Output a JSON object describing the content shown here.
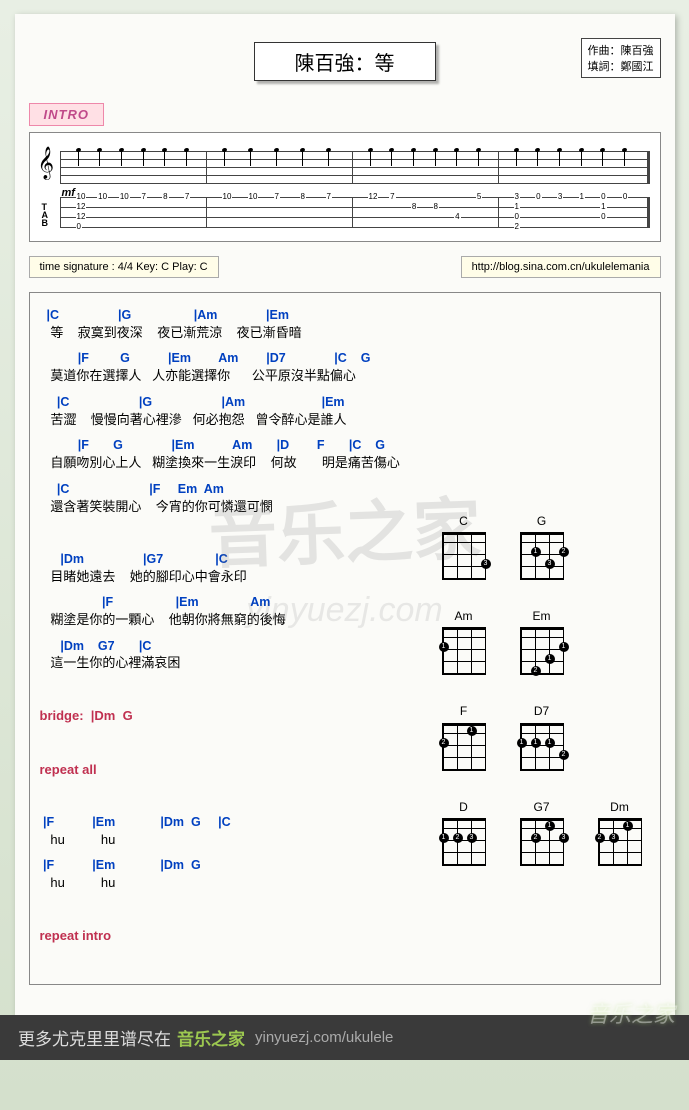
{
  "title": "陳百強：等",
  "credits": {
    "composer_label": "作曲：陳百強",
    "lyricist_label": "填詞：鄭國江"
  },
  "intro_label": "INTRO",
  "dynamic": "mf",
  "tab_intro": {
    "bars": [
      {
        "cols": [
          {
            "s1": "10",
            "s2": "12",
            "s3": "12",
            "s4": "0"
          },
          {
            "s1": "10"
          },
          {
            "s1": "10"
          },
          {
            "s1": "7",
            "s3": "",
            "s4": ""
          },
          {
            "s1": "8"
          },
          {
            "s1": "7"
          }
        ]
      },
      {
        "cols": [
          {
            "s1": "10"
          },
          {
            "s1": "10"
          },
          {
            "s1": "7"
          },
          {
            "s1": "8"
          },
          {
            "s1": "7"
          }
        ]
      },
      {
        "cols": [
          {
            "s1": "12",
            "s2": "",
            "s3": "",
            "s4": ""
          },
          {
            "s1": "7"
          },
          {
            "s2": "8"
          },
          {
            "s2": "8"
          },
          {
            "s3": "4"
          },
          {
            "s1": "5"
          }
        ]
      },
      {
        "cols": [
          {
            "s1": "3",
            "s2": "1",
            "s3": "0",
            "s4": "2"
          },
          {
            "s1": "0"
          },
          {
            "s1": "3"
          },
          {
            "s1": "1"
          },
          {
            "s1": "0",
            "s2": "1",
            "s3": "0",
            "s4": ""
          },
          {
            "s1": "0"
          }
        ]
      }
    ]
  },
  "meta": {
    "text": "time signature :  4/4   Key:  C     Play:  C"
  },
  "blog_link": "http://blog.sina.com.cn/ukulelemania",
  "lyrics_block": [
    {
      "c": "  |C                 |G                  |Am              |Em",
      "l": "   等    寂寞到夜深    夜已漸荒涼    夜已漸昏暗"
    },
    {
      "c": "           |F         G           |Em        Am        |D7              |C    G",
      "l": "   莫道你在選擇人   人亦能選擇你      公平原沒半點偏心"
    },
    {
      "c": "     |C                    |G                    |Am                      |Em",
      "l": "   苦澀    慢慢向著心裡滲   何必抱怨   曾令醉心是誰人"
    },
    {
      "c": "           |F       G              |Em           Am       |D        F       |C    G",
      "l": "   自願吻別心上人   糊塗換來一生淚印    何故       明是痛苦傷心"
    },
    {
      "c": "     |C                       |F     Em  Am",
      "l": "   還含著笑裝開心    今宵的你可憐還可憫"
    },
    {
      "c": "",
      "l": ""
    },
    {
      "c": "      |Dm                 |G7               |C",
      "l": "   目睹她遠去    她的腳印心中會永印"
    },
    {
      "c": "                  |F                  |Em               Am",
      "l": "   糊塗是你的一顆心    他朝你將無窮的後悔"
    },
    {
      "c": "      |Dm    G7       |C",
      "l": "   這一生你的心裡滿哀困"
    },
    {
      "c": "",
      "l": ""
    },
    {
      "c": "",
      "l": "",
      "red": "bridge:  |Dm  G"
    },
    {
      "c": "",
      "l": ""
    },
    {
      "c": "",
      "l": "",
      "red": "repeat all"
    },
    {
      "c": "",
      "l": ""
    },
    {
      "c": " |F           |Em             |Dm  G     |C",
      "l": "   hu          hu"
    },
    {
      "c": " |F           |Em             |Dm  G",
      "l": "   hu          hu"
    },
    {
      "c": "",
      "l": ""
    },
    {
      "c": "",
      "l": "",
      "red": "repeat intro"
    }
  ],
  "chord_diagrams": [
    {
      "row": 0,
      "name": "C",
      "dots": [
        {
          "f": 3,
          "s": 1,
          "n": "3"
        }
      ]
    },
    {
      "row": 0,
      "name": "G",
      "dots": [
        {
          "f": 2,
          "s": 1,
          "n": "2"
        },
        {
          "f": 3,
          "s": 2,
          "n": "3"
        },
        {
          "f": 2,
          "s": 3,
          "n": "1"
        }
      ]
    },
    {
      "row": 1,
      "name": "Am",
      "dots": [
        {
          "f": 2,
          "s": 4,
          "n": "1"
        }
      ]
    },
    {
      "row": 1,
      "name": "Em",
      "dots": [
        {
          "f": 4,
          "s": 3,
          "n": "2"
        },
        {
          "f": 3,
          "s": 2,
          "n": "1"
        },
        {
          "f": 2,
          "s": 1,
          "n": "1"
        }
      ]
    },
    {
      "row": 2,
      "name": "F",
      "dots": [
        {
          "f": 1,
          "s": 2,
          "n": "1"
        },
        {
          "f": 2,
          "s": 4,
          "n": "2"
        }
      ]
    },
    {
      "row": 2,
      "name": "D7",
      "dots": [
        {
          "f": 2,
          "s": 4,
          "n": "1"
        },
        {
          "f": 2,
          "s": 3,
          "n": "1"
        },
        {
          "f": 2,
          "s": 2,
          "n": "1"
        },
        {
          "f": 3,
          "s": 1,
          "n": "2"
        }
      ]
    },
    {
      "row": 3,
      "name": "D",
      "dots": [
        {
          "f": 2,
          "s": 4,
          "n": "1"
        },
        {
          "f": 2,
          "s": 3,
          "n": "2"
        },
        {
          "f": 2,
          "s": 2,
          "n": "3"
        }
      ]
    },
    {
      "row": 3,
      "name": "G7",
      "dots": [
        {
          "f": 1,
          "s": 2,
          "n": "1"
        },
        {
          "f": 2,
          "s": 3,
          "n": "2"
        },
        {
          "f": 2,
          "s": 1,
          "n": "3"
        }
      ]
    },
    {
      "row": 3,
      "name": "Dm",
      "dots": [
        {
          "f": 2,
          "s": 4,
          "n": "2"
        },
        {
          "f": 2,
          "s": 3,
          "n": "3"
        },
        {
          "f": 1,
          "s": 2,
          "n": "1"
        }
      ]
    }
  ],
  "watermark_main": "音乐之家",
  "watermark_sub": "yinyuezj.com",
  "footer": {
    "prefix": "更多尤克里里谱尽在",
    "brand": "音乐之家",
    "url": "yinyuezj.com/ukulele",
    "logo": "音乐之家"
  }
}
